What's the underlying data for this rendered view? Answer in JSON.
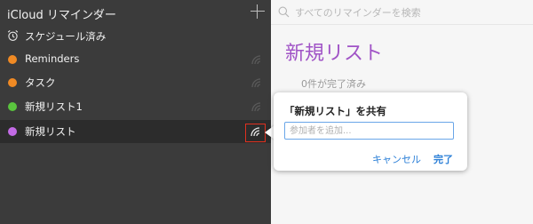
{
  "sidebar": {
    "title": "iCloud リマインダー",
    "scheduled_label": "スケジュール済み",
    "items": [
      {
        "label": "Reminders",
        "color": "#f08a24"
      },
      {
        "label": "タスク",
        "color": "#f08a24"
      },
      {
        "label": "新規リスト1",
        "color": "#5ac43e"
      },
      {
        "label": "新規リスト",
        "color": "#c36be6"
      }
    ]
  },
  "search": {
    "placeholder": "すべてのリマインダーを検索"
  },
  "main": {
    "title": "新規リスト",
    "completed": "0件が完了済み",
    "title_color": "#a053c6"
  },
  "popover": {
    "title": "「新規リスト」を共有",
    "input_placeholder": "参加者を追加...",
    "cancel_label": "キャンセル",
    "done_label": "完了"
  }
}
